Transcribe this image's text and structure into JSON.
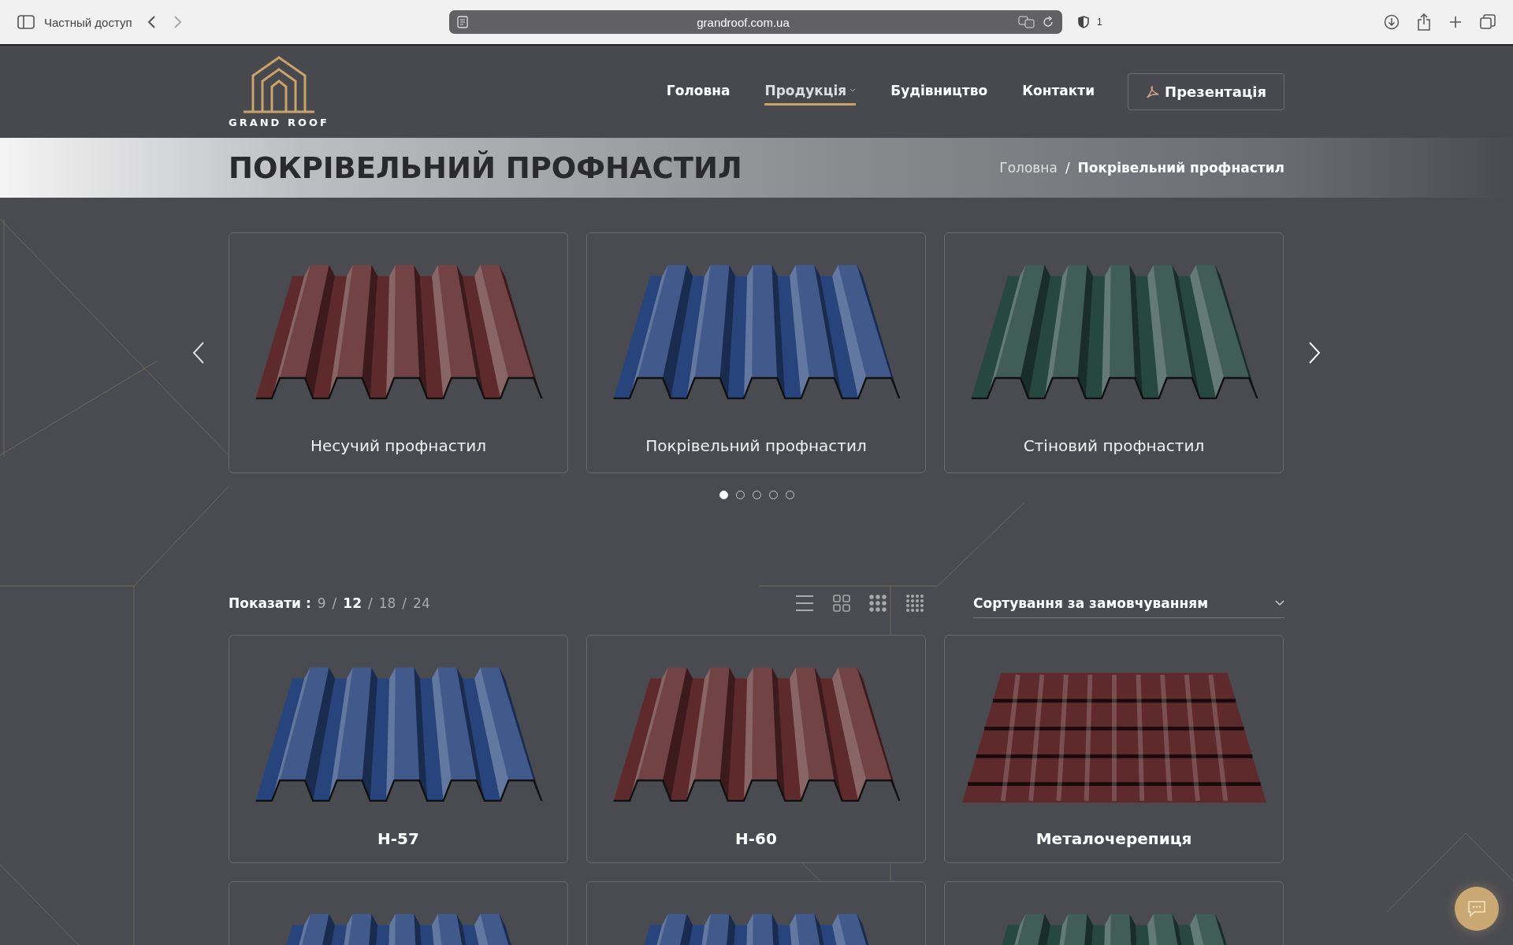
{
  "browser": {
    "sidebar_label": "Частный доступ",
    "url": "grandroof.com.ua",
    "shield_count": "1"
  },
  "logo": {
    "text": "GRAND ROOF"
  },
  "nav": [
    {
      "label": "Головна",
      "selected": false,
      "dropdown": false
    },
    {
      "label": "Продукція",
      "selected": true,
      "dropdown": true
    },
    {
      "label": "Будівництво",
      "selected": false,
      "dropdown": false
    },
    {
      "label": "Контакти",
      "selected": false,
      "dropdown": false
    }
  ],
  "presentation_button": "Презентація",
  "banner": {
    "title": "ПОКРІВЕЛЬНИЙ ПРОФНАСТИЛ",
    "separator": "/",
    "breadcrumbs": [
      "Головна",
      "Покрівельний профнастил"
    ]
  },
  "carousel": {
    "slides": [
      {
        "name": "Несучий профнастил",
        "kind": "profile",
        "color": "#5e2a2c"
      },
      {
        "name": "Покрівельний профнастил",
        "kind": "profile",
        "color": "#27447c"
      },
      {
        "name": "Стіновий профнастил",
        "kind": "profile",
        "color": "#27483f"
      }
    ],
    "dots": [
      {
        "selected": true
      },
      {
        "selected": false
      },
      {
        "selected": false
      },
      {
        "selected": false
      },
      {
        "selected": false
      }
    ]
  },
  "toolbar": {
    "show_label": "Показати :",
    "separator": "/",
    "page_sizes": [
      {
        "label": "9",
        "selected": false
      },
      {
        "label": "12",
        "selected": true
      },
      {
        "label": "18",
        "selected": false
      },
      {
        "label": "24",
        "selected": false
      }
    ],
    "sort": "Сортування за замовчуванням"
  },
  "products": [
    {
      "name": "Н-57",
      "kind": "profile",
      "color": "#27447c"
    },
    {
      "name": "Н-60",
      "kind": "profile",
      "color": "#5e2a2c"
    },
    {
      "name": "Металочерепиця",
      "kind": "tile",
      "color": "#5e2a2c"
    },
    {
      "kind": "profile",
      "color": "#27447c"
    },
    {
      "kind": "profile",
      "color": "#27447c"
    },
    {
      "kind": "profile",
      "color": "#27483f"
    }
  ]
}
